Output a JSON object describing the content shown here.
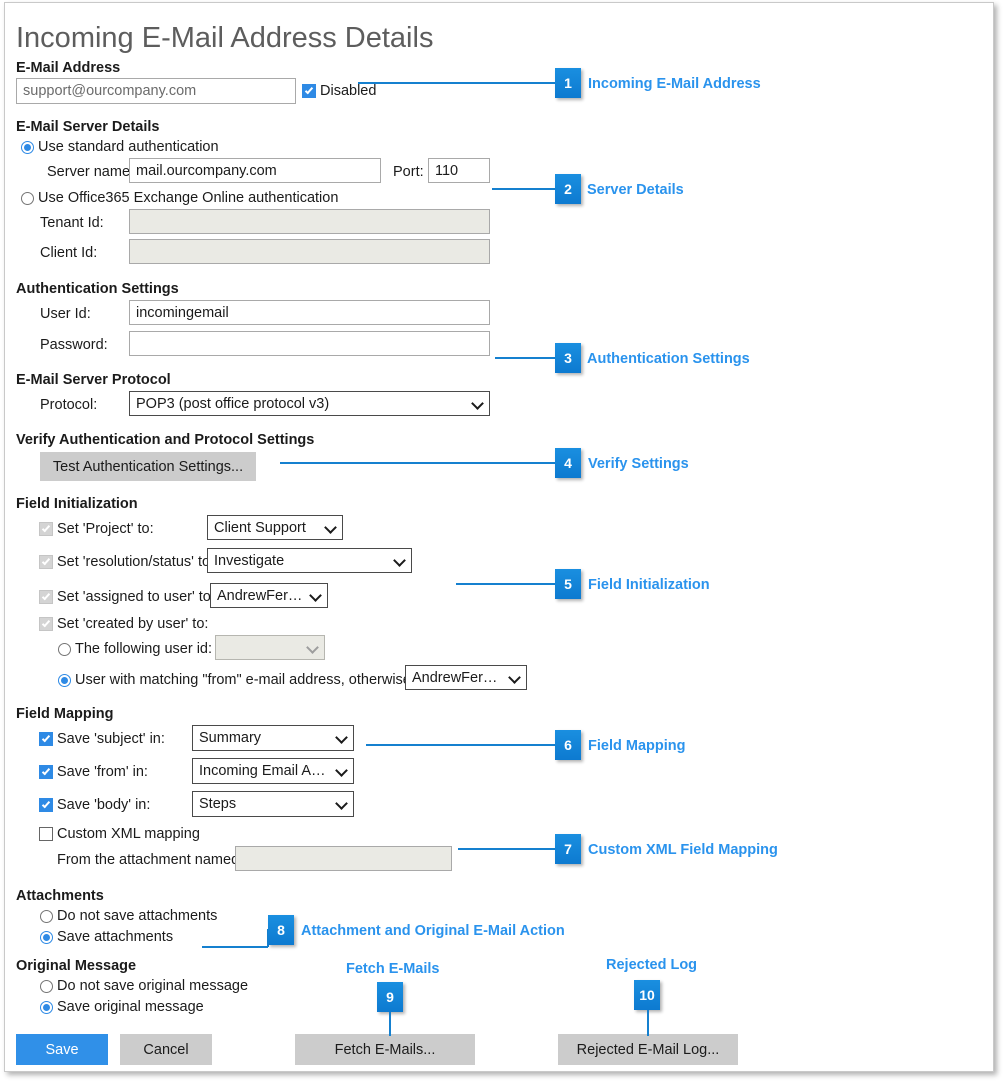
{
  "page": {
    "title": "Incoming E-Mail Address Details"
  },
  "colors": {
    "accent": "#2e8ae5",
    "callout_badge": "#1580cf",
    "callout_text": "#2a93ed",
    "title_text": "#5d5d5d",
    "button_face": "#cccccc",
    "disabled_field": "#eaeae4"
  },
  "sections": {
    "email_address": {
      "heading": "E-Mail Address",
      "address_value": "support@ourcompany.com",
      "disabled_label": "Disabled",
      "disabled_checked": true
    },
    "server_details": {
      "heading": "E-Mail Server Details",
      "standard_auth_label": "Use standard authentication",
      "standard_auth_selected": true,
      "server_name_label": "Server name:",
      "server_name_value": "mail.ourcompany.com",
      "port_label": "Port:",
      "port_value": "110",
      "office365_label": "Use Office365 Exchange Online authentication",
      "office365_selected": false,
      "tenant_id_label": "Tenant Id:",
      "tenant_id_value": "",
      "client_id_label": "Client Id:",
      "client_id_value": ""
    },
    "authentication_settings": {
      "heading": "Authentication Settings",
      "user_id_label": "User Id:",
      "user_id_value": "incomingemail",
      "password_label": "Password:",
      "password_value": ""
    },
    "server_protocol": {
      "heading": "E-Mail Server Protocol",
      "protocol_label": "Protocol:",
      "protocol_value": "POP3 (post office protocol v3)"
    },
    "verify_settings": {
      "heading": "Verify Authentication and Protocol Settings",
      "test_button_label": "Test Authentication Settings..."
    },
    "field_initialization": {
      "heading": "Field Initialization",
      "rows": [
        {
          "label": "Set 'Project' to:",
          "checked": true,
          "disabled": true,
          "value": "Client Support"
        },
        {
          "label": "Set 'resolution/status' to:",
          "checked": true,
          "disabled": true,
          "value": "Investigate"
        },
        {
          "label": "Set 'assigned to user' to:",
          "checked": true,
          "disabled": true,
          "value": "AndrewFerguson"
        },
        {
          "label": "Set 'created by user' to:",
          "checked": true,
          "disabled": true,
          "value": ""
        }
      ],
      "following_user_id_label": "The following user id:",
      "following_user_id_selected": false,
      "following_user_id_value": "",
      "matching_from_label": "User with matching \"from\" e-mail address, otherwise:",
      "matching_from_selected": true,
      "matching_from_value": "AndrewFerguson"
    },
    "field_mapping": {
      "heading": "Field Mapping",
      "rows": [
        {
          "label": "Save 'subject' in:",
          "checked": true,
          "value": "Summary"
        },
        {
          "label": "Save 'from' in:",
          "checked": true,
          "value": "Incoming Email Address"
        },
        {
          "label": "Save 'body' in:",
          "checked": true,
          "value": "Steps"
        }
      ],
      "custom_xml_label": "Custom XML mapping",
      "custom_xml_checked": false,
      "attachment_named_label": "From the attachment named:",
      "attachment_named_value": ""
    },
    "attachments": {
      "heading": "Attachments",
      "options": [
        {
          "label": "Do not save attachments",
          "selected": false
        },
        {
          "label": "Save attachments",
          "selected": true
        }
      ]
    },
    "original_message": {
      "heading": "Original Message",
      "options": [
        {
          "label": "Do not save original message",
          "selected": false
        },
        {
          "label": "Save original message",
          "selected": true
        }
      ]
    }
  },
  "footer": {
    "save_label": "Save",
    "cancel_label": "Cancel",
    "fetch_label": "Fetch E-Mails...",
    "rejected_log_label": "Rejected E-Mail Log..."
  },
  "callouts": [
    {
      "number": "1",
      "label": "Incoming E-Mail Address"
    },
    {
      "number": "2",
      "label": "Server Details"
    },
    {
      "number": "3",
      "label": "Authentication Settings"
    },
    {
      "number": "4",
      "label": "Verify Settings"
    },
    {
      "number": "5",
      "label": "Field Initialization"
    },
    {
      "number": "6",
      "label": "Field Mapping"
    },
    {
      "number": "7",
      "label": "Custom XML Field Mapping"
    },
    {
      "number": "8",
      "label": "Attachment and Original E-Mail Action"
    },
    {
      "number": "9",
      "label": "Fetch E-Mails"
    },
    {
      "number": "10",
      "label": "Rejected Log"
    }
  ]
}
